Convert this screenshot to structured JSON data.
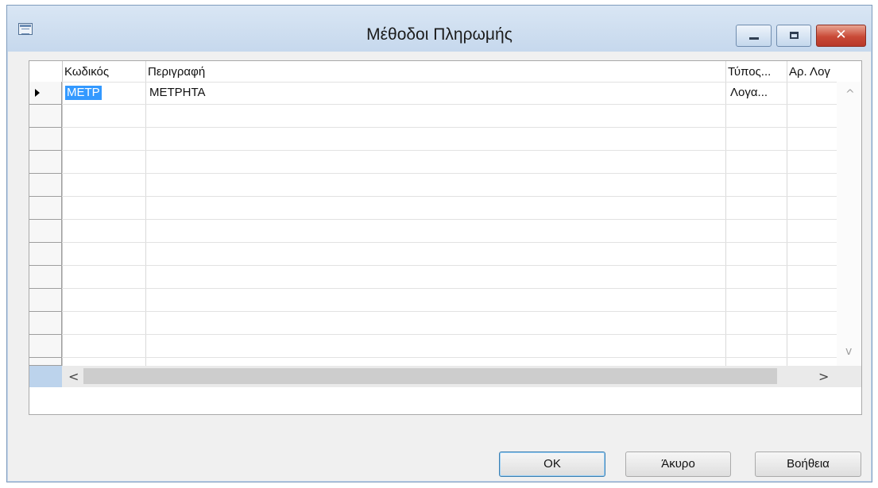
{
  "window": {
    "title": "Μέθοδοι Πληρωμής",
    "close_symbol": "✕"
  },
  "grid": {
    "columns": [
      "Κωδικός",
      "Περιγραφή",
      "Τύπος...",
      "Αρ. Λογ"
    ],
    "rows": [
      {
        "code": "ΜΕΤΡ",
        "description": "ΜΕΤΡΗΤΑ",
        "type": "Λογα...",
        "account": ""
      }
    ]
  },
  "scrollbar": {
    "up": "^",
    "down": "v",
    "left": "<",
    "right": ">"
  },
  "buttons": {
    "ok": "OK",
    "cancel": "Άκυρο",
    "help": "Βοήθεια"
  },
  "colors": {
    "selection": "#3399ff",
    "window_frame": "#c7d9ee",
    "close_button": "#c94a37"
  }
}
